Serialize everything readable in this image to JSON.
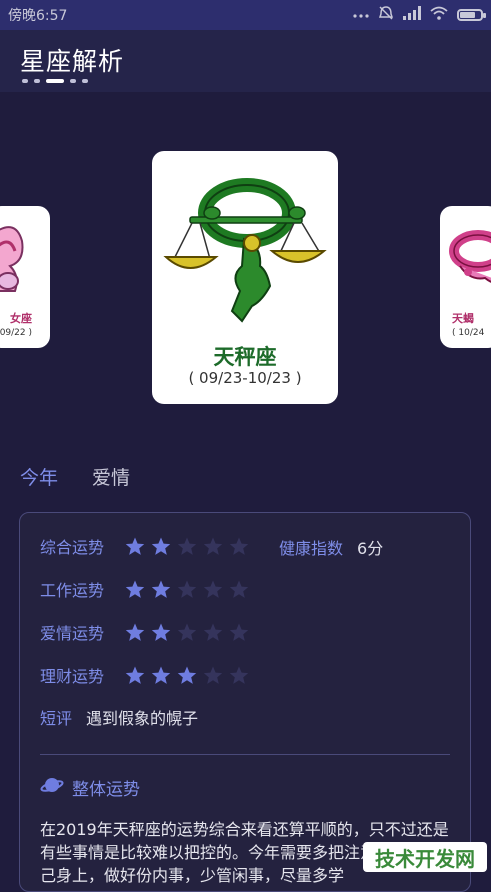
{
  "statusbar": {
    "time": "傍晚6:57",
    "icons": [
      "more-icon",
      "alarm-off-icon",
      "signal-icon",
      "wifi-icon",
      "battery-icon"
    ]
  },
  "appbar": {
    "title": "星座解析"
  },
  "carousel": {
    "current": {
      "name": "天秤座",
      "date": "( 09/23-10/23 )"
    },
    "prev": {
      "name": "女座",
      "date": "09/22 )"
    },
    "next": {
      "name": "天蝎",
      "date": "( 10/24"
    }
  },
  "tabs": [
    {
      "label": "今年",
      "active": true
    },
    {
      "label": "爱情",
      "active": false
    }
  ],
  "fortune": {
    "rows": [
      {
        "label": "综合运势",
        "stars": 2,
        "max": 5
      },
      {
        "label": "工作运势",
        "stars": 2,
        "max": 5
      },
      {
        "label": "爱情运势",
        "stars": 2,
        "max": 5
      },
      {
        "label": "理财运势",
        "stars": 3,
        "max": 5
      }
    ],
    "health_label": "健康指数",
    "health_value": "6分",
    "short_label": "短评",
    "short_value": "遇到假象的幌子",
    "overall_title": "整体运势",
    "overall_text": "在2019年天秤座的运势综合来看还算平顺的，只不过还是有些事情是比较难以把控的。今年需要多把注意力放在自己身上，做好份内事，少管闲事，尽量多学",
    "colors": {
      "star_on": "#6f7de0",
      "star_off": "#35345c",
      "accent": "#7e8de8"
    }
  },
  "watermark": "技术开发网"
}
